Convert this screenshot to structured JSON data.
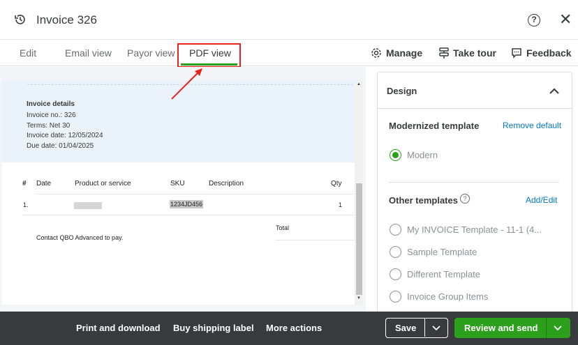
{
  "header": {
    "title": "Invoice 326",
    "help_icon": "?",
    "close_icon": "✕"
  },
  "tabs": [
    {
      "label": "Edit"
    },
    {
      "label": "Email view"
    },
    {
      "label": "Payor view"
    },
    {
      "label": "PDF view"
    }
  ],
  "actions": {
    "manage": "Manage",
    "tour": "Take tour",
    "feedback": "Feedback"
  },
  "invoice": {
    "heading": "Invoice details",
    "no": "Invoice no.: 326",
    "terms": "Terms: Net 30",
    "date": "Invoice date: 12/05/2024",
    "due": "Due date: 01/04/2025",
    "columns": [
      "#",
      "Date",
      "Product or service",
      "SKU",
      "Description",
      "Qty"
    ],
    "rows": [
      {
        "num": "1.",
        "sku": "1234JD456",
        "qty": "1"
      }
    ],
    "total_label": "Total",
    "contact": "Contact QBO Advanced to pay."
  },
  "design": {
    "title": "Design",
    "modernized": "Modernized template",
    "remove_default": "Remove default",
    "modern": "Modern",
    "other": "Other templates",
    "add_edit": "Add/Edit",
    "templates": [
      "My INVOICE Template - 11-1 (4...",
      "Sample Template",
      "Different Template",
      "Invoice Group Items"
    ]
  },
  "footer": {
    "print": "Print and download",
    "shipping": "Buy shipping label",
    "more": "More actions",
    "save": "Save",
    "send": "Review and send"
  },
  "colors": {
    "accent": "#2ca01c",
    "annotation": "#e8231b",
    "footer": "#393a3d"
  }
}
